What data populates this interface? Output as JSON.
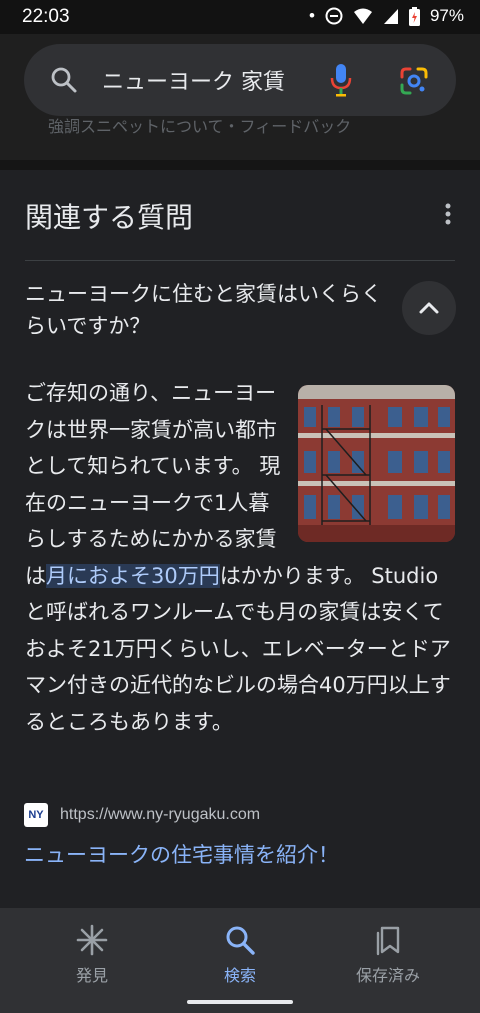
{
  "status": {
    "time": "22:03",
    "battery": "97%"
  },
  "search": {
    "query": "ニューヨーク 家賃"
  },
  "faded_text": "強調スニペットについて・フィードバック",
  "related": {
    "title": "関連する質問",
    "question": "ニューヨークに住むと家賃はいくらくらいですか？",
    "answer_before": "ご存知の通り、ニューヨークは世界一家賃が高い都市として知られています。 現在のニューヨークで1人暮らしするためにかかる家賃は",
    "answer_highlight": "月におよそ30万円",
    "answer_after": "はかかります。 Studioと呼ばれるワンルームでも月の家賃は安くておよそ21万円くらいし、エレベーターとドアマン付きの近代的なビルの場合40万円以上するところもあります。",
    "source_url": "https://www.ny-ryugaku.com",
    "favicon_text": "NY",
    "link_title": "ニューヨークの住宅事情を紹介！"
  },
  "nav": [
    {
      "label": "発見",
      "icon": "asterisk-icon"
    },
    {
      "label": "検索",
      "icon": "search-icon"
    },
    {
      "label": "保存済み",
      "icon": "collections-icon"
    }
  ],
  "colors": {
    "accent": "#8ab4f8",
    "background": "#202124",
    "highlight": "#2a3a55"
  }
}
